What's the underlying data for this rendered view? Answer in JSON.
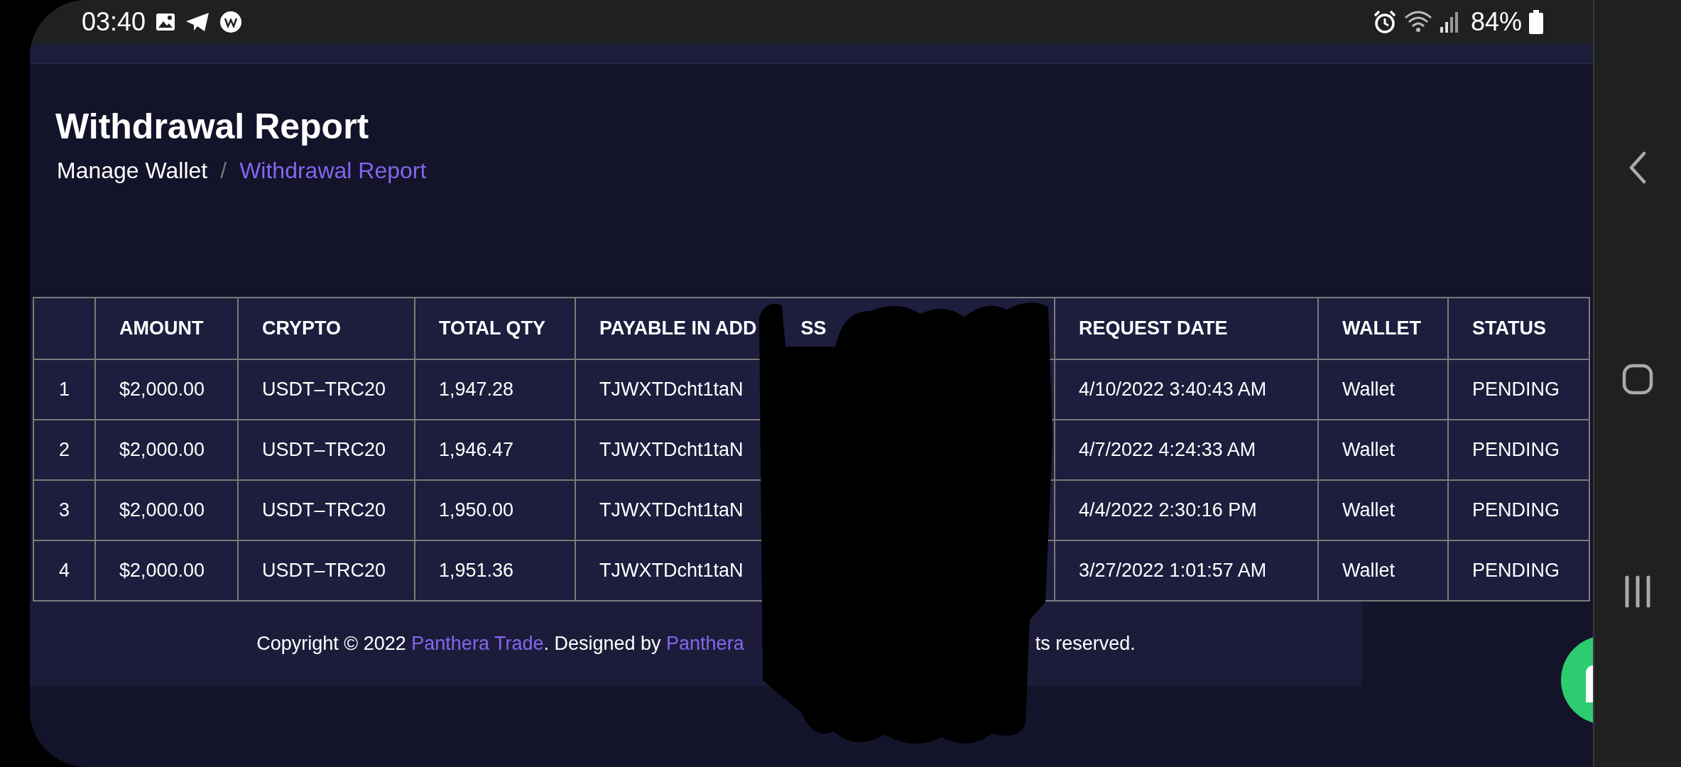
{
  "status_bar": {
    "time": "03:40",
    "battery": "84%"
  },
  "page": {
    "title": "Withdrawal Report",
    "breadcrumb_separator": "/",
    "breadcrumb": [
      {
        "label": "Manage Wallet",
        "selected": false
      },
      {
        "label": "Withdrawal Report",
        "selected": true
      }
    ]
  },
  "table": {
    "columns": [
      "AMOUNT",
      "CRYPTO",
      "TOTAL QTY",
      "PAYABLE IN ADD",
      "REQUEST DATE",
      "WALLET",
      "STATUS"
    ],
    "covered_header_tail": "SS",
    "rows": [
      {
        "no": "1",
        "amount": "$2,000.00",
        "crypto": "USDT–TRC20",
        "total_qty": "1,947.28",
        "address": "TJWXTDcht1taN",
        "request_date": "4/10/2022 3:40:43 AM",
        "wallet": "Wallet",
        "status": "PENDING"
      },
      {
        "no": "2",
        "amount": "$2,000.00",
        "crypto": "USDT–TRC20",
        "total_qty": "1,946.47",
        "address": "TJWXTDcht1taN",
        "request_date": "4/7/2022 4:24:33 AM",
        "wallet": "Wallet",
        "status": "PENDING"
      },
      {
        "no": "3",
        "amount": "$2,000.00",
        "crypto": "USDT–TRC20",
        "total_qty": "1,950.00",
        "address": "TJWXTDcht1taN",
        "request_date": "4/4/2022 2:30:16 PM",
        "wallet": "Wallet",
        "status": "PENDING"
      },
      {
        "no": "4",
        "amount": "$2,000.00",
        "crypto": "USDT–TRC20",
        "total_qty": "1,951.36",
        "address": "TJWXTDcht1taN",
        "request_date": "3/27/2022 1:01:57 AM",
        "wallet": "Wallet",
        "status": "PENDING"
      }
    ]
  },
  "footer": {
    "parts": [
      {
        "kind": "text",
        "text": "Copyright © 2022 "
      },
      {
        "kind": "link",
        "text": "Panthera Trade"
      },
      {
        "kind": "text",
        "text": ". Designed by "
      },
      {
        "kind": "link",
        "text": "Panthera"
      }
    ],
    "tail": "ts reserved."
  }
}
